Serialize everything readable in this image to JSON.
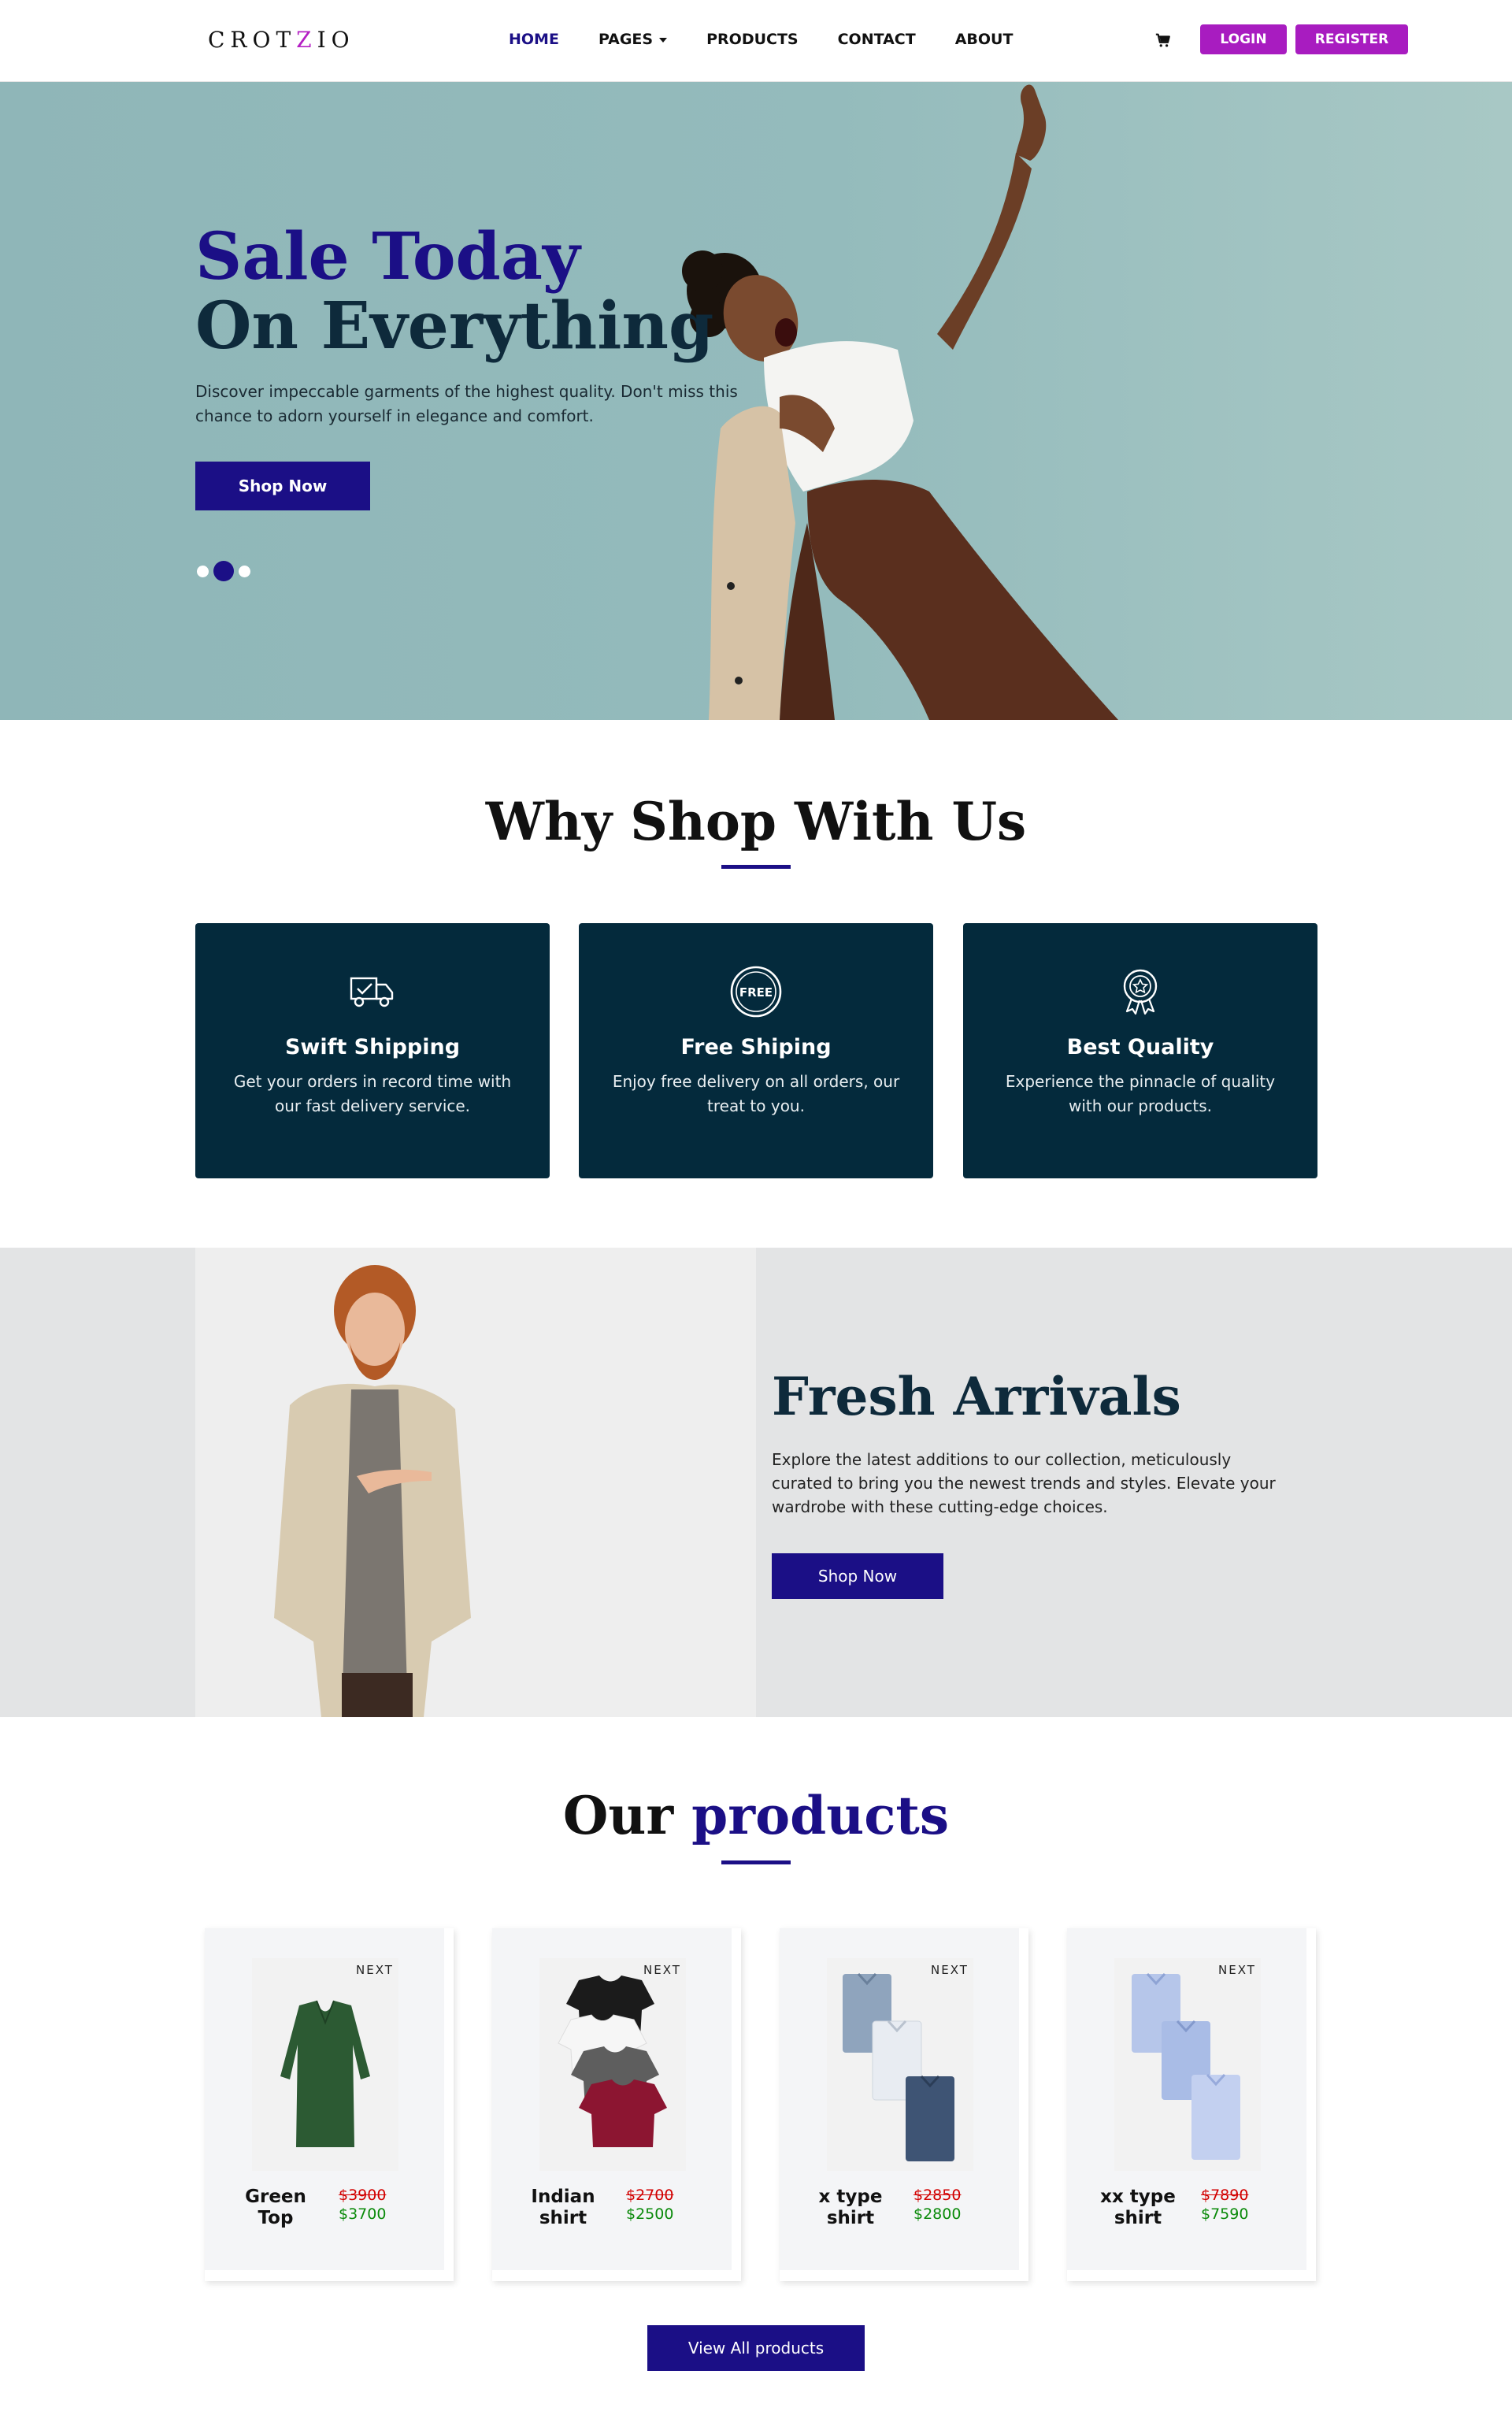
{
  "header": {
    "logo_pre": "CROT",
    "logo_accent": "Z",
    "logo_post": "IO",
    "nav": [
      {
        "label": "HOME"
      },
      {
        "label": "PAGES"
      },
      {
        "label": "PRODUCTS"
      },
      {
        "label": "CONTACT"
      },
      {
        "label": "ABOUT"
      }
    ],
    "login": "LOGIN",
    "register": "REGISTER",
    "brand_color": "#a81cc0",
    "active_color": "#1b0f86"
  },
  "hero": {
    "title_line1": "Sale Today",
    "title_line2": "On Everything",
    "description": "Discover impeccable garments of the highest quality. Don't miss this chance to adorn yourself in elegance and comfort.",
    "button": "Shop Now",
    "slides": 3,
    "active_slide": 2
  },
  "why": {
    "title": "Why Shop With Us",
    "features": [
      {
        "icon": "truck-icon",
        "title": "Swift Shipping",
        "desc": "Get your orders in record time with our fast delivery service."
      },
      {
        "icon": "free-badge-icon",
        "title": "Free Shiping",
        "desc": "Enjoy free delivery on all orders, our treat to you."
      },
      {
        "icon": "award-ribbon-icon",
        "title": "Best Quality",
        "desc": "Experience the pinnacle of quality with our products."
      }
    ]
  },
  "arrivals": {
    "title": "Fresh Arrivals",
    "description": "Explore the latest additions to our collection, meticulously curated to bring you the newest trends and styles. Elevate your wardrobe with these cutting-edge choices.",
    "button": "Shop Now"
  },
  "products": {
    "title_pre": "Our",
    "title_hl": "products",
    "items": [
      {
        "brand": "NEXT",
        "name": "Green Top",
        "old_price": "$3900",
        "new_price": "$3700"
      },
      {
        "brand": "NEXT",
        "name": "Indian shirt",
        "old_price": "$2700",
        "new_price": "$2500"
      },
      {
        "brand": "NEXT",
        "name": "x type shirt",
        "old_price": "$2850",
        "new_price": "$2800"
      },
      {
        "brand": "NEXT",
        "name": "xx type shirt",
        "old_price": "$7890",
        "new_price": "$7590"
      }
    ],
    "view_all": "View All products"
  }
}
